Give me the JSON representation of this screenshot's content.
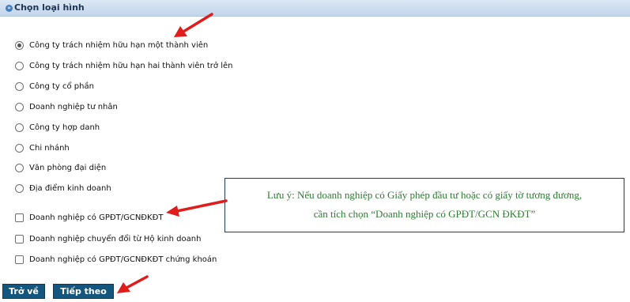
{
  "header": {
    "title": "Chọn loại hình"
  },
  "types": [
    {
      "label": "Công ty trách nhiệm hữu hạn một thành viên",
      "selected": true
    },
    {
      "label": "Công ty trách nhiệm hữu hạn hai thành viên trở lên",
      "selected": false
    },
    {
      "label": "Công ty cổ phần",
      "selected": false
    },
    {
      "label": "Doanh nghiệp tư nhân",
      "selected": false
    },
    {
      "label": "Công ty hợp danh",
      "selected": false
    },
    {
      "label": "Chi nhánh",
      "selected": false
    },
    {
      "label": "Văn phòng đại diện",
      "selected": false
    },
    {
      "label": "Địa điểm kinh doanh",
      "selected": false
    }
  ],
  "options": [
    {
      "label": "Doanh nghiệp có GPĐT/GCNĐKĐT",
      "checked": false
    },
    {
      "label": "Doanh nghiệp chuyển đổi từ Hộ kinh doanh",
      "checked": false
    },
    {
      "label": "Doanh nghiệp có GPĐT/GCNĐKĐT chứng khoán",
      "checked": false
    }
  ],
  "note": {
    "line1": "Lưu ý: Nếu doanh nghiệp có Giấy phép đầu tư hoặc có giấy tờ tương đương,",
    "line2": "cần tích chọn “Doanh nghiệp có GPĐT/GCN ĐKĐT”"
  },
  "buttons": {
    "back": "Trở về",
    "next": "Tiếp theo"
  },
  "colors": {
    "annotation_arrow": "#e01c1c",
    "note_text": "#2e7d32",
    "button_bg": "#14567d"
  }
}
